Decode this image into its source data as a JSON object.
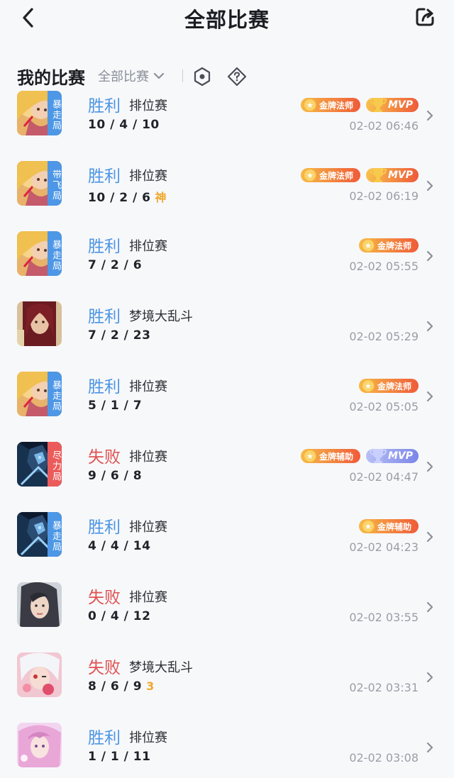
{
  "header": {
    "title": "全部比赛"
  },
  "filter": {
    "section_title": "我的比赛",
    "select_label": "全部比赛"
  },
  "icons": {
    "back": "chevron-left-icon",
    "share": "share-icon",
    "hex": "hexagon-settings-icon",
    "help": "help-diamond-icon"
  },
  "colors": {
    "win": "#4c95e3",
    "lose": "#e05151",
    "tag_blue": "#4d97e6",
    "tag_red": "#ec5b5b",
    "kda_extra": "#f0a82b"
  },
  "matches": [
    {
      "result": "胜利",
      "mode": "排位赛",
      "kda": "10 / 4 / 10",
      "extra": "",
      "time": "02-02 06:46",
      "tag": "暴走局",
      "hero": "gold-hair-mage",
      "medal": "金牌法师",
      "mvp": "MVP"
    },
    {
      "result": "胜利",
      "mode": "排位赛",
      "kda": "10 / 2 / 6",
      "extra": "神",
      "time": "02-02 06:19",
      "tag": "带飞局",
      "hero": "gold-hair-mage",
      "medal": "金牌法师",
      "mvp": "MVP"
    },
    {
      "result": "胜利",
      "mode": "排位赛",
      "kda": "7 / 2 / 6",
      "extra": "",
      "time": "02-02 05:55",
      "tag": "暴走局",
      "hero": "gold-hair-mage",
      "medal": "金牌法师",
      "mvp": ""
    },
    {
      "result": "胜利",
      "mode": "梦境大乱斗",
      "kda": "7 / 2 / 23",
      "extra": "",
      "time": "02-02 05:29",
      "tag": "",
      "hero": "red-hair-hero",
      "medal": "",
      "mvp": ""
    },
    {
      "result": "胜利",
      "mode": "排位赛",
      "kda": "5 / 1 / 7",
      "extra": "",
      "time": "02-02 05:05",
      "tag": "暴走局",
      "hero": "gold-hair-mage",
      "medal": "金牌法师",
      "mvp": ""
    },
    {
      "result": "失败",
      "mode": "排位赛",
      "kda": "9 / 6 / 8",
      "extra": "",
      "time": "02-02 04:47",
      "tag": "尽力局",
      "hero": "armored-knight",
      "medal": "金牌辅助",
      "mvp": "MVP"
    },
    {
      "result": "胜利",
      "mode": "排位赛",
      "kda": "4 / 4 / 14",
      "extra": "",
      "time": "02-02 04:23",
      "tag": "暴走局",
      "hero": "armored-knight",
      "medal": "金牌辅助",
      "mvp": ""
    },
    {
      "result": "失败",
      "mode": "排位赛",
      "kda": "0 / 4 / 12",
      "extra": "",
      "time": "02-02 03:55",
      "tag": "",
      "hero": "dark-hair-lady",
      "medal": "",
      "mvp": ""
    },
    {
      "result": "失败",
      "mode": "梦境大乱斗",
      "kda": "8 / 6 / 9",
      "extra": "3",
      "time": "02-02 03:31",
      "tag": "",
      "hero": "white-hair-girl",
      "medal": "",
      "mvp": ""
    },
    {
      "result": "胜利",
      "mode": "排位赛",
      "kda": "1 / 1 / 11",
      "extra": "",
      "time": "02-02 03:08",
      "tag": "",
      "hero": "pink-hair-girl",
      "medal": "",
      "mvp": ""
    }
  ]
}
